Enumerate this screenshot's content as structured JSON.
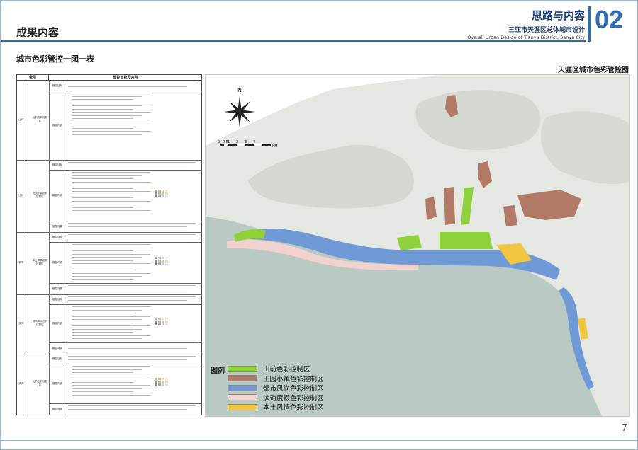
{
  "header": {
    "left_title": "成果内容",
    "right_title": "思路与内容",
    "right_sub_cn": "三亚市天涯区总体城市设计",
    "right_sub_en": "Overall Urban Design of Tianya District, Sanya City",
    "chapter_num": "02"
  },
  "section_title": "城市色彩管控一图一表",
  "map_title": "天涯区城市色彩管控图",
  "page_number": "7",
  "table": {
    "col1": "索引",
    "col2": "管控目标及内容",
    "groups": [
      {
        "cat": "山体",
        "sub": "山前色彩控制区",
        "rows": [
          "管控目标",
          "管控内容"
        ]
      },
      {
        "cat": "山体",
        "sub": "田园小镇色彩控制区",
        "rows": [
          "管控目标",
          "管控内容",
          "管控对象"
        ]
      },
      {
        "cat": "城市",
        "sub": "本土风情色彩控制区",
        "rows": [
          "管控目标",
          "管控内容",
          "管控对象"
        ]
      },
      {
        "cat": "滨海",
        "sub": "都市风尚色彩控制区",
        "rows": [
          "管控目标",
          "管控内容",
          "管控对象"
        ]
      },
      {
        "cat": "滨海",
        "sub": "山前色彩控制区",
        "rows": [
          "管控目标",
          "管控内容",
          "管控对象"
        ]
      }
    ]
  },
  "map": {
    "compass_label": "N",
    "scale_ticks": [
      "0",
      "0.5",
      "1",
      "2",
      "3",
      "4"
    ],
    "scale_unit": "KM"
  },
  "legend": {
    "title": "图例",
    "items": [
      {
        "label": "山前色彩控制区",
        "color": "#8ed13a"
      },
      {
        "label": "田园小镇色彩控制区",
        "color": "#b07a66"
      },
      {
        "label": "都市风尚色彩控制区",
        "color": "#6f9ad6"
      },
      {
        "label": "滨海度假色彩控制区",
        "color": "#f2d2cf"
      },
      {
        "label": "本土风情色彩控制区",
        "color": "#f2c640"
      }
    ]
  },
  "colors": {
    "accent": "#2f6db3",
    "sea": "#b9c9c4",
    "land": "#e7e9e4"
  }
}
